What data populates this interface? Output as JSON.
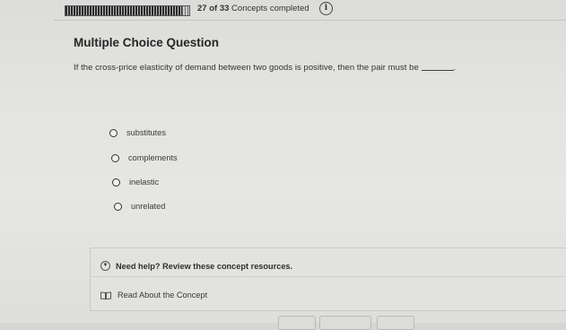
{
  "header": {
    "progress_fraction": 0.94,
    "completed_count": "27",
    "of_word": "of",
    "total_count": "33",
    "completed_label": "Concepts completed",
    "info_icon": "info-icon"
  },
  "question": {
    "type_title": "Multiple Choice Question",
    "prompt": "If the cross-price elasticity of demand between two goods is positive, then the pair must be",
    "prompt_suffix": "."
  },
  "options": [
    {
      "label": "substitutes"
    },
    {
      "label": "complements"
    },
    {
      "label": "inelastic"
    },
    {
      "label": "unrelated"
    }
  ],
  "help": {
    "toggle_label": "Need help? Review these concept resources.",
    "toggle_icon": "chevron-down-icon",
    "resource_label": "Read About the Concept",
    "resource_icon": "book-icon"
  }
}
